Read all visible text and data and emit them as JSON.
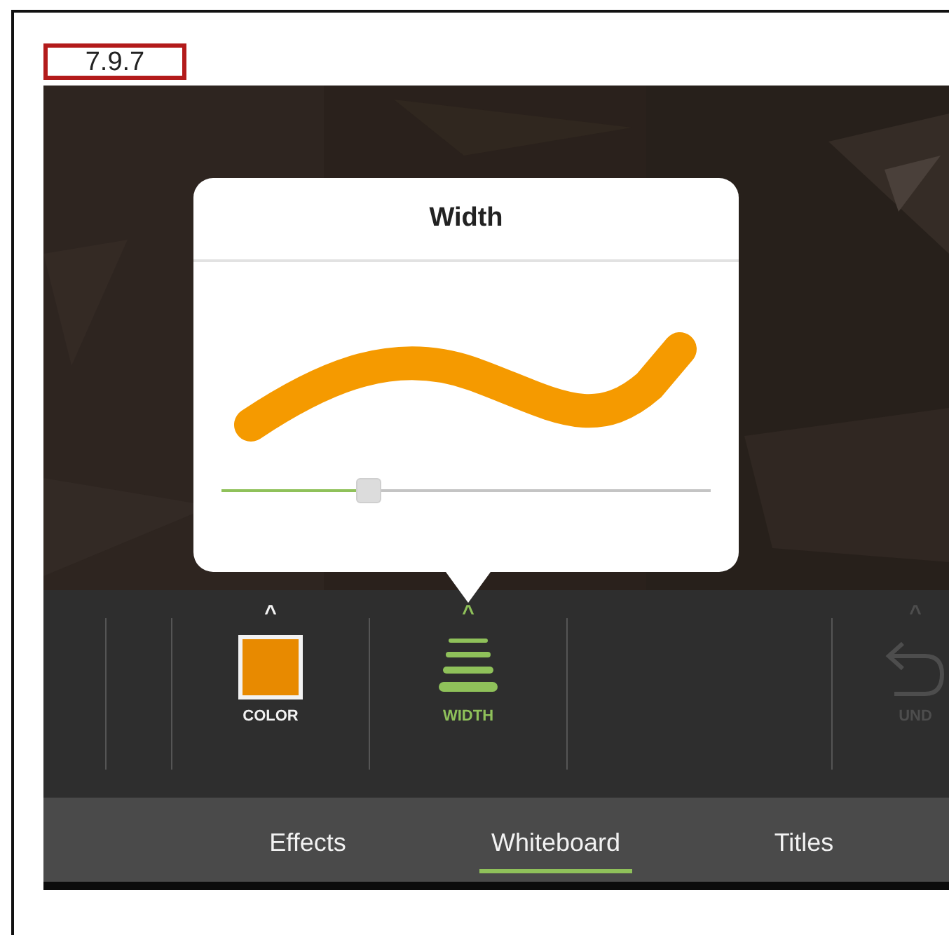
{
  "figure_label": "7.9.7",
  "popover": {
    "title": "Width",
    "slider": {
      "level": 0.3
    }
  },
  "toolbar": {
    "tools": [
      {
        "kind": "swatch",
        "label": "COLOR",
        "color": "#e88a00",
        "selected": false,
        "caret": "^"
      },
      {
        "kind": "width",
        "label": "WIDTH",
        "selected": true,
        "caret": "^"
      },
      {
        "kind": "undo",
        "label": "UND",
        "selected": false,
        "disabled": true,
        "caret": "^"
      }
    ]
  },
  "tabs": [
    {
      "label": "Effects",
      "selected": false
    },
    {
      "label": "Whiteboard",
      "selected": true
    },
    {
      "label": "Titles",
      "selected": false
    }
  ]
}
